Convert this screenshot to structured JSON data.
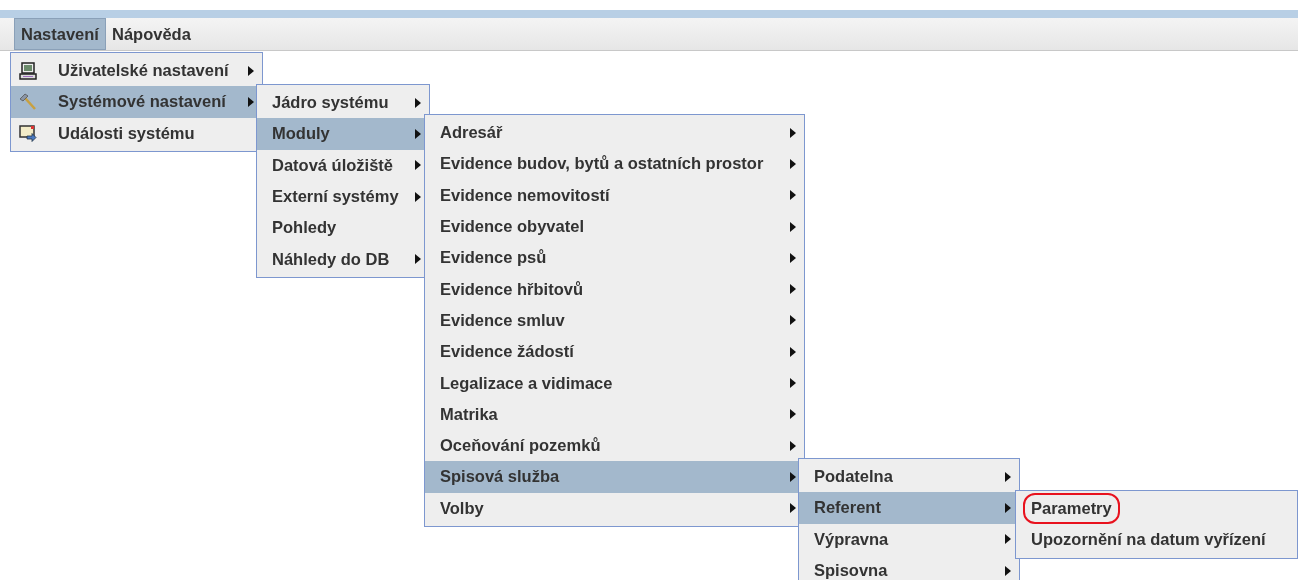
{
  "menubar": [
    {
      "label": "Nastavení",
      "selected": true
    },
    {
      "label": "Nápověda",
      "selected": false
    }
  ],
  "menus": [
    {
      "items": [
        {
          "label": "Uživatelské nastavení",
          "kind": "icon",
          "submenu": true,
          "selected": false
        },
        {
          "label": "Systémové nastavení",
          "kind": "icon",
          "submenu": true,
          "selected": true
        },
        {
          "label": "Události systému",
          "kind": "icon",
          "submenu": false,
          "selected": false
        }
      ]
    },
    {
      "items": [
        {
          "label": "Jádro systému",
          "kind": "plain",
          "submenu": true,
          "selected": false
        },
        {
          "label": "Moduly",
          "kind": "plain",
          "submenu": true,
          "selected": true
        },
        {
          "label": "Datová úložiště",
          "kind": "plain",
          "submenu": true,
          "selected": false
        },
        {
          "label": "Externí systémy",
          "kind": "plain",
          "submenu": true,
          "selected": false
        },
        {
          "label": "Pohledy",
          "kind": "plain",
          "submenu": false,
          "selected": false
        },
        {
          "label": "Náhledy do DB",
          "kind": "plain",
          "submenu": true,
          "selected": false
        }
      ]
    },
    {
      "items": [
        {
          "label": "Adresář",
          "kind": "plain",
          "submenu": true,
          "selected": false
        },
        {
          "label": "Evidence budov, bytů a ostatních prostor",
          "kind": "plain",
          "submenu": true,
          "selected": false
        },
        {
          "label": "Evidence nemovitostí",
          "kind": "plain",
          "submenu": true,
          "selected": false
        },
        {
          "label": "Evidence obyvatel",
          "kind": "plain",
          "submenu": true,
          "selected": false
        },
        {
          "label": "Evidence psů",
          "kind": "plain",
          "submenu": true,
          "selected": false
        },
        {
          "label": "Evidence hřbitovů",
          "kind": "plain",
          "submenu": true,
          "selected": false
        },
        {
          "label": "Evidence smluv",
          "kind": "plain",
          "submenu": true,
          "selected": false
        },
        {
          "label": "Evidence žádostí",
          "kind": "plain",
          "submenu": true,
          "selected": false
        },
        {
          "label": "Legalizace a vidimace",
          "kind": "plain",
          "submenu": true,
          "selected": false
        },
        {
          "label": "Matrika",
          "kind": "plain",
          "submenu": true,
          "selected": false
        },
        {
          "label": "Oceňování pozemků",
          "kind": "plain",
          "submenu": true,
          "selected": false
        },
        {
          "label": "Spisová služba",
          "kind": "plain",
          "submenu": true,
          "selected": true
        },
        {
          "label": "Volby",
          "kind": "plain",
          "submenu": true,
          "selected": false
        }
      ]
    },
    {
      "items": [
        {
          "label": "Podatelna",
          "kind": "plain",
          "submenu": true,
          "selected": false
        },
        {
          "label": "Referent",
          "kind": "plain",
          "submenu": true,
          "selected": true
        },
        {
          "label": "Výpravna",
          "kind": "plain",
          "submenu": true,
          "selected": false
        },
        {
          "label": "Spisovna",
          "kind": "plain",
          "submenu": true,
          "selected": false
        }
      ]
    },
    {
      "items": [
        {
          "label": "Parametry",
          "kind": "plain",
          "submenu": false,
          "selected": false,
          "circled": true
        },
        {
          "label": "Upozornění na datum vyřízení",
          "kind": "plain",
          "submenu": false,
          "selected": false,
          "circled": false
        }
      ]
    }
  ]
}
